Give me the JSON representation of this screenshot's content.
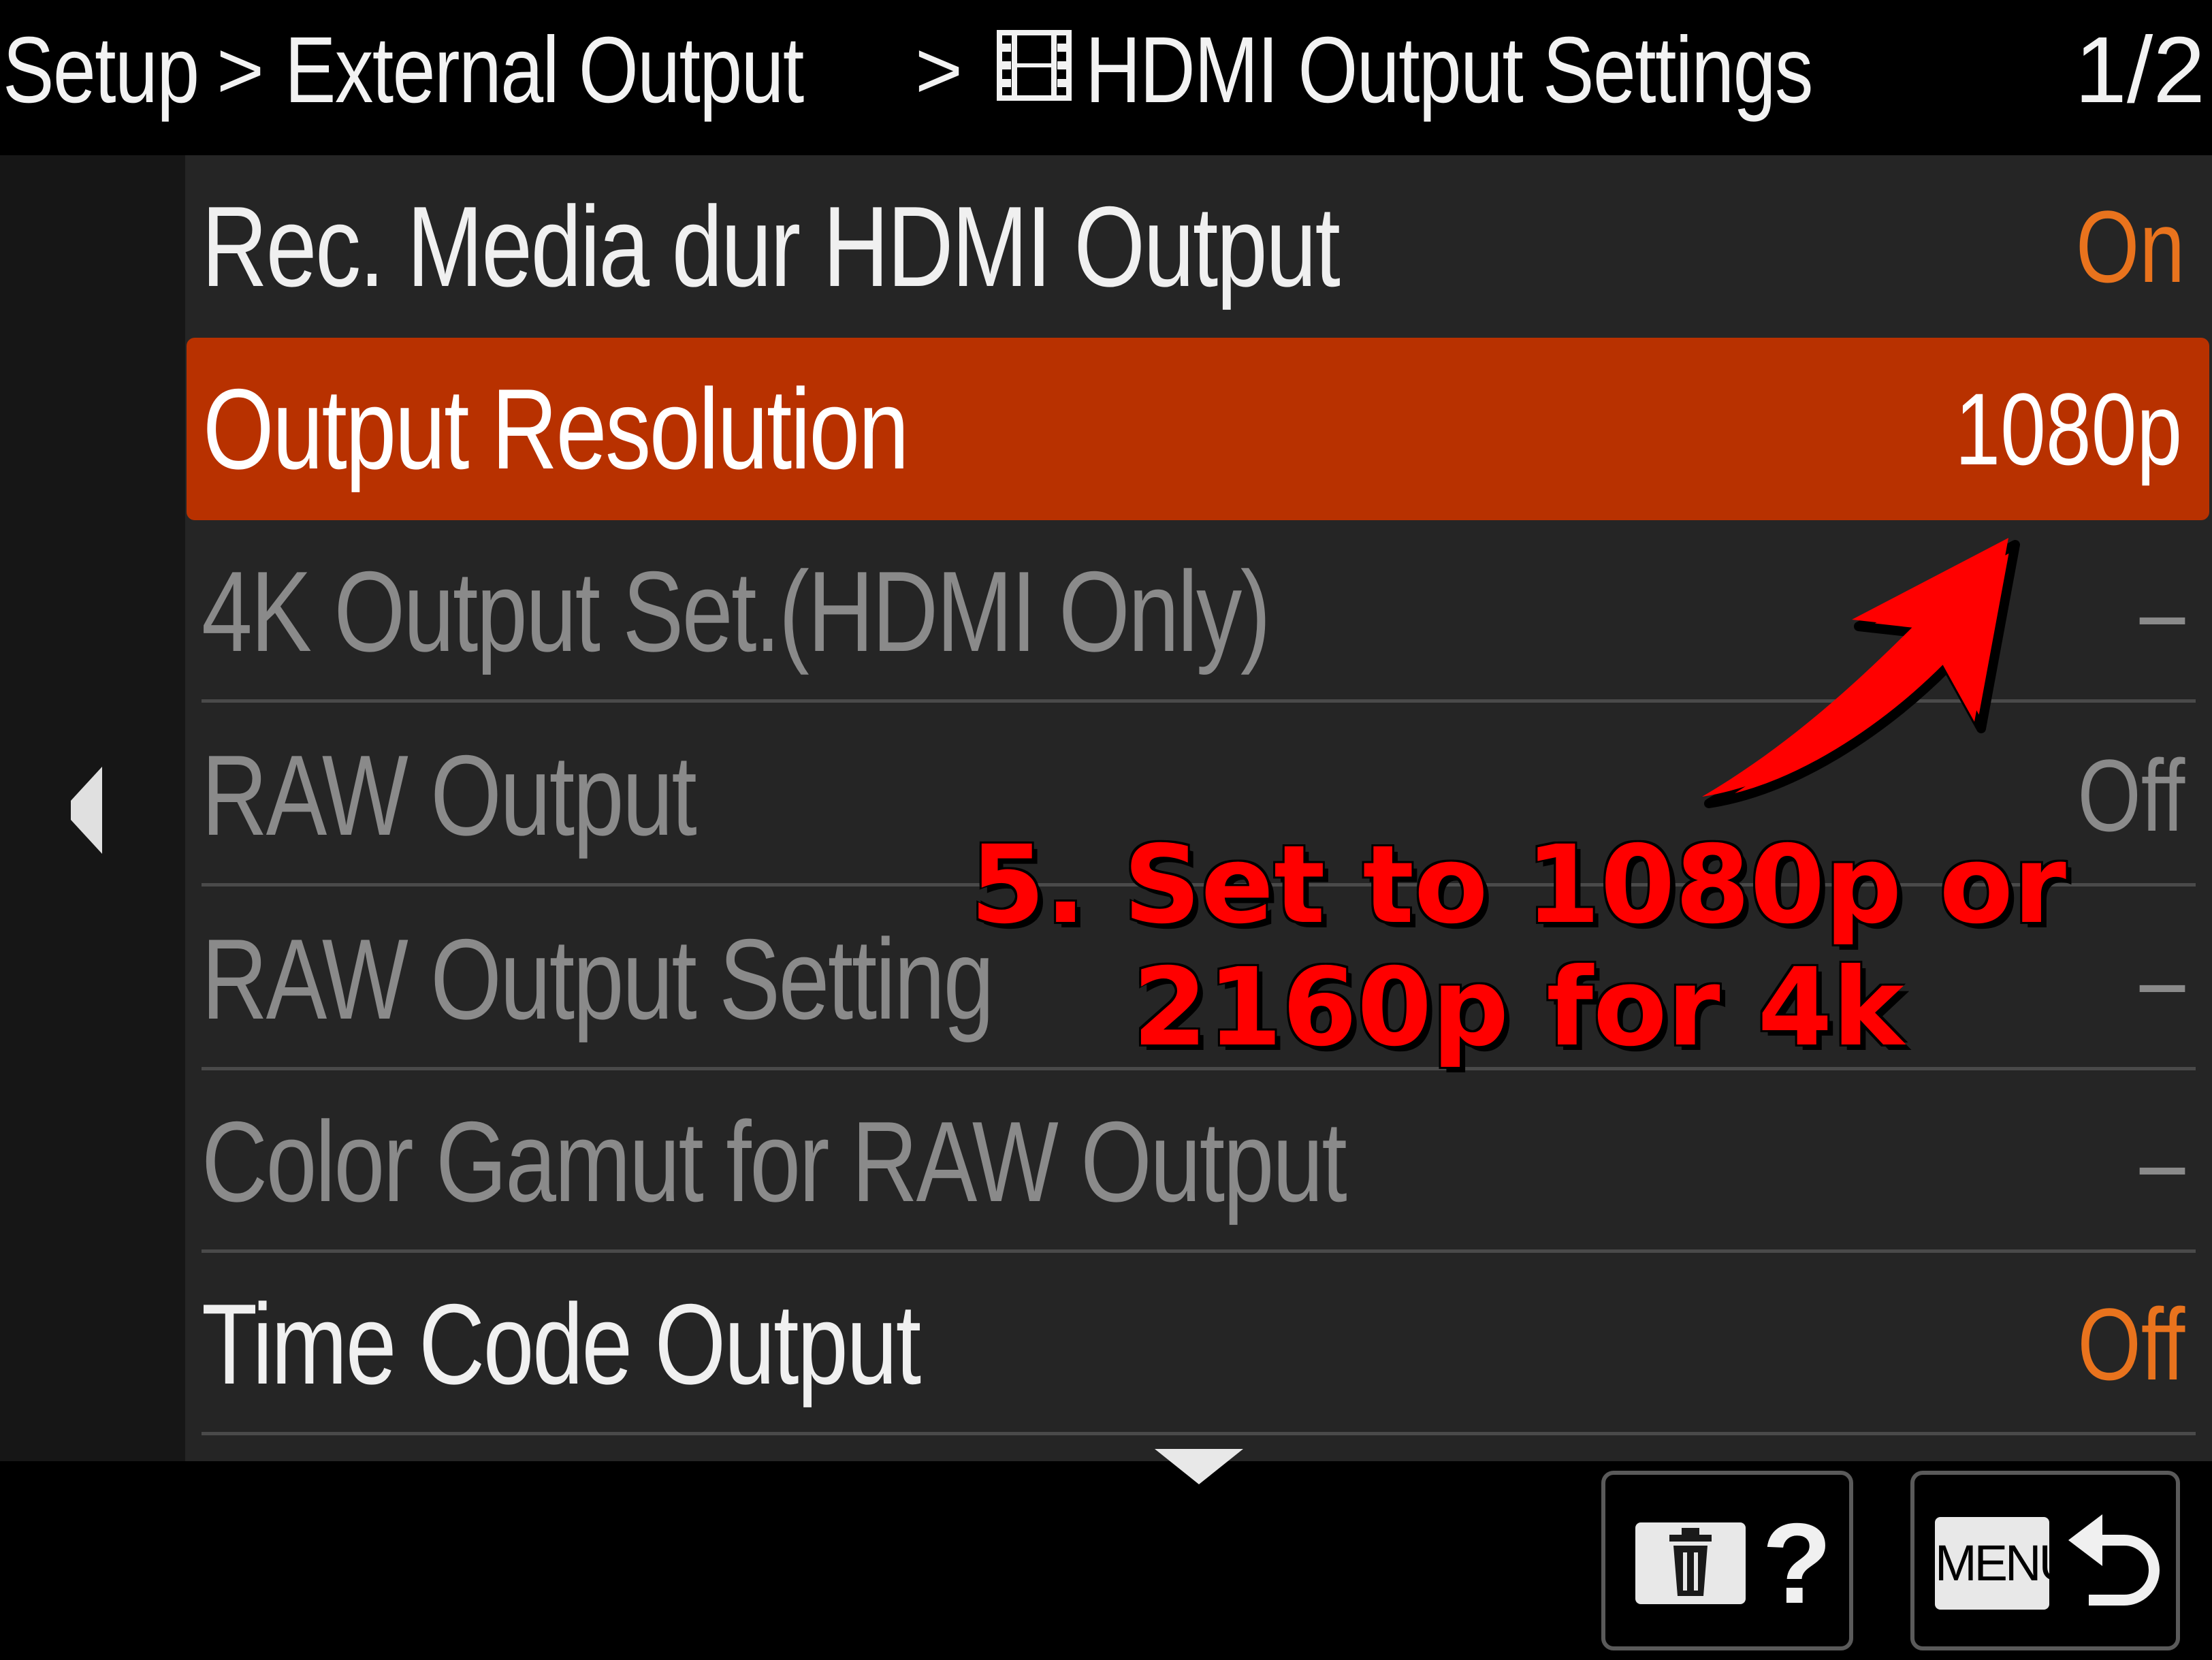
{
  "header": {
    "crumbs": [
      "Setup",
      "External Output",
      "HDMI Output Settings"
    ],
    "separator": ">",
    "page_indicator": "1/2"
  },
  "menu": {
    "items": [
      {
        "label": "Rec. Media dur HDMI Output",
        "value": "On",
        "state": "enabled"
      },
      {
        "label": "Output Resolution",
        "value": "1080p",
        "state": "selected"
      },
      {
        "label": "4K Output Set.(HDMI Only)",
        "value": "–",
        "state": "disabled"
      },
      {
        "label": "RAW Output",
        "value": "Off",
        "state": "disabled"
      },
      {
        "label": "RAW Output Setting",
        "value": "–",
        "state": "disabled"
      },
      {
        "label": "Color Gamut for RAW Output",
        "value": "–",
        "state": "disabled"
      },
      {
        "label": "Time Code Output",
        "value": "Off",
        "state": "enabled"
      }
    ]
  },
  "footer": {
    "help_symbol": "?",
    "menu_label": "MENU"
  },
  "annotation": {
    "line1": "5. Set to 1080p or",
    "line2": "2160p for 4k"
  },
  "icons": {
    "film": "film-icon",
    "back": "left-arrow-icon",
    "scroll": "down-arrow-icon",
    "delete": "trash-icon",
    "return": "return-icon"
  },
  "colors": {
    "selected_bg": "#b83100",
    "value_orange": "#e9731d",
    "disabled_text": "#8a8a8a",
    "annotation": "#ff0000"
  }
}
